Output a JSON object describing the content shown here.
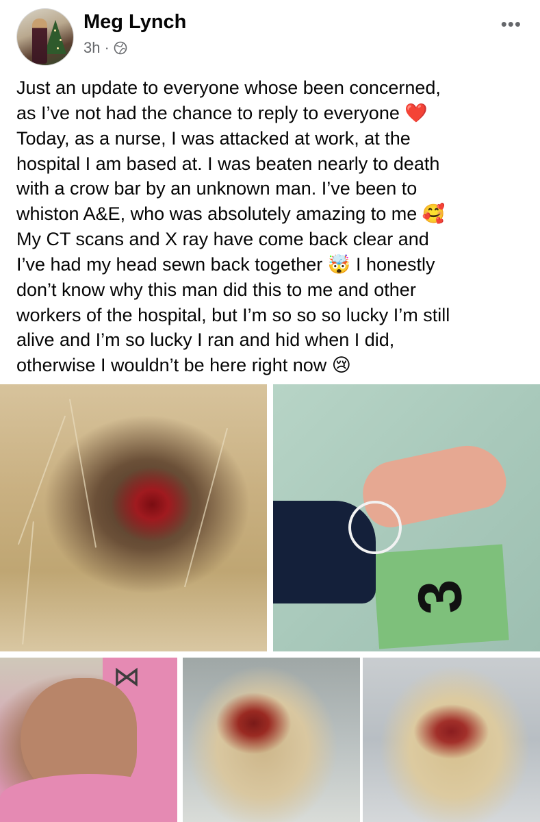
{
  "post": {
    "author_name": "Meg Lynch",
    "time_ago": "3h",
    "separator": "·",
    "privacy_icon": "globe-icon",
    "more_icon": "more-options-icon",
    "more_glyph": "•••",
    "text_lines": [
      "Just an update to everyone whose been concerned,",
      "as I’ve not had the chance to reply to everyone",
      "Today, as a nurse, I was attacked at work, at the",
      "hospital I am based at. I was beaten nearly to death",
      "with a crow bar by an unknown man. I’ve been to",
      "whiston A&E, who was absolutely amazing to me",
      "My CT scans and X ray have come back clear and",
      "I’ve had my head sewn back together",
      "I honestly",
      "don’t know why this man did this to me and other",
      "workers of the hospital, but I’m so so so lucky I’m still",
      "alive and I’m so lucky I ran and hid when I did,",
      "otherwise I wouldn’t be here right now"
    ],
    "emojis": {
      "heart": "❤️",
      "smiling_hearts": "🥰",
      "exploding_head": "🤯",
      "crying": "😢"
    },
    "photos": {
      "card_number": "3"
    }
  },
  "colors": {
    "text": "#050505",
    "meta": "#65676b",
    "heart": "#e0245e"
  }
}
